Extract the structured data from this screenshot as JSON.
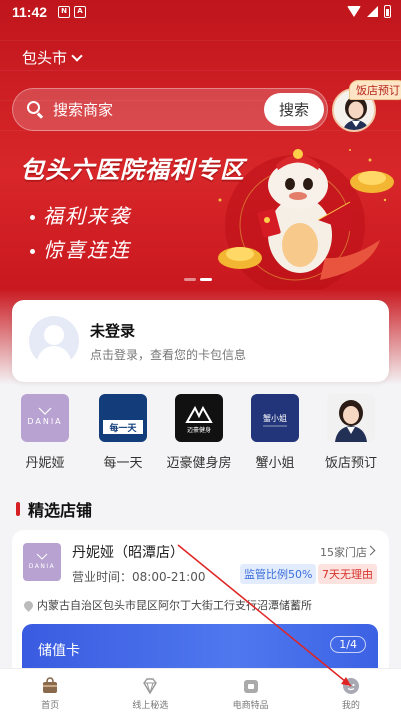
{
  "status_bar": {
    "time": "11:42",
    "icon_a": "N",
    "icon_b": "A"
  },
  "city": {
    "label": "包头市"
  },
  "search": {
    "placeholder": "搜索商家",
    "button_label": "搜索"
  },
  "hotel_shortcut": {
    "tag": "饭店预订"
  },
  "banner": {
    "title": "包头六医院福利专区",
    "line1": "福利来袭",
    "line2": "惊喜连连"
  },
  "login": {
    "title": "未登录",
    "subtitle": "点击登录，查看您的卡包信息"
  },
  "brands": [
    {
      "label": "丹妮娅",
      "logo_text": "DANIA"
    },
    {
      "label": "每一天",
      "logo_text": "每一天"
    },
    {
      "label": "迈豪健身房",
      "logo_text": "迈豪健身"
    },
    {
      "label": "蟹小姐",
      "logo_text": "蟹小姐"
    },
    {
      "label": "饭店预订",
      "logo_text": ""
    }
  ],
  "section": {
    "title": "精选店铺"
  },
  "store": {
    "name": "丹妮娅（昭潭店）",
    "count": "15家门店",
    "hours": "营业时间：08:00-21:00",
    "tag_supervision": "监管比例50%",
    "tag_refund": "7天无理由",
    "address": "内蒙古自治区包头市昆区阿尔丁大街工行支行沼潭储蓄所",
    "value_card_title": "储值卡",
    "value_card_page": "1/4"
  },
  "tabs": [
    {
      "label": "首页"
    },
    {
      "label": "线上秘选"
    },
    {
      "label": "电商特品"
    },
    {
      "label": "我的"
    }
  ],
  "colors": {
    "primary_red": "#d61f24",
    "value_card_blue": "#3a5be0",
    "tag_blue": "#3a6edb",
    "tag_red": "#d8322b"
  }
}
